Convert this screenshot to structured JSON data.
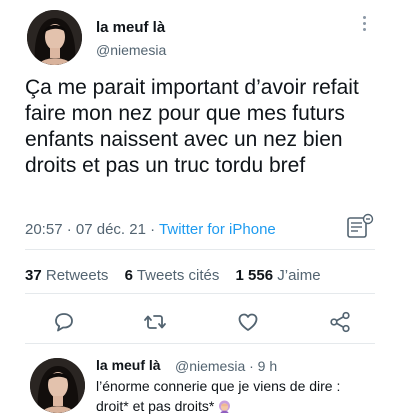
{
  "tweet": {
    "author_name": "la meuf là",
    "author_handle": "@niemesia",
    "text": "Ça me parait important d’avoir refait faire mon nez pour que mes futurs enfants naissent avec un nez bien droits et pas un truc tordu bref",
    "time": "20:57",
    "date": "07 déc. 21",
    "separator": "·",
    "source": "Twitter for iPhone"
  },
  "stats": {
    "retweets_count": "37",
    "retweets_label": "Retweets",
    "quotes_count": "6",
    "quotes_label": "Tweets cités",
    "likes_count": "1 556",
    "likes_label": "J’aime"
  },
  "actions": {
    "icons": [
      "reply-icon",
      "retweet-icon",
      "like-icon",
      "share-icon"
    ]
  },
  "reply": {
    "author_name": "la meuf là",
    "author_handle": "@niemesia · 9 h",
    "text_line1": "l’énorme connerie que je viens de dire :",
    "text_line2": "droit* et pas droits*"
  },
  "colors": {
    "accent": "#1d9bf0",
    "secondary_text": "#536471",
    "primary_text": "#0f1419",
    "icon_gray": "#536471"
  }
}
